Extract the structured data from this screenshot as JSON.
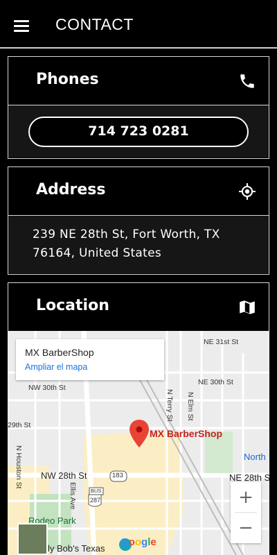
{
  "appbar": {
    "title": "CONTACT",
    "menu_icon": "hamburger-menu-icon"
  },
  "phones": {
    "title": "Phones",
    "icon": "phone-icon",
    "number": "714 723 0281"
  },
  "address": {
    "title": "Address",
    "icon": "crosshair-location-icon",
    "text": "239 NE 28th St, Fort Worth, TX 76164, United States"
  },
  "location": {
    "title": "Location",
    "icon": "map-icon",
    "map": {
      "place_name": "MX BarberShop",
      "enlarge_link": "Ampliar el mapa",
      "marker_label": "MX BarberShop",
      "streets": {
        "ne31": "NE 31st St",
        "ne30": "NE 30th St",
        "nw30": "NW 30th St",
        "st29": "29th St",
        "nw28": "NW 28th St",
        "ne28": "NE 28th St",
        "houston": "N Houston St",
        "terry": "N Terry St",
        "elm": "N Elm St",
        "ellis": "Ellis Ave",
        "hwy183": "183",
        "hwy287": "287",
        "bus": "BUS"
      },
      "places": {
        "rodeo": "Rodeo Park",
        "bobs": "ly Bob's Texas",
        "north": "North"
      },
      "zoom_in": "+",
      "zoom_out": "−",
      "logo": "Google"
    }
  },
  "colors": {
    "background": "#000000",
    "card_body": "#161616",
    "border": "#d8d8d8",
    "marker": "#ea4335",
    "link": "#1a73e8"
  }
}
